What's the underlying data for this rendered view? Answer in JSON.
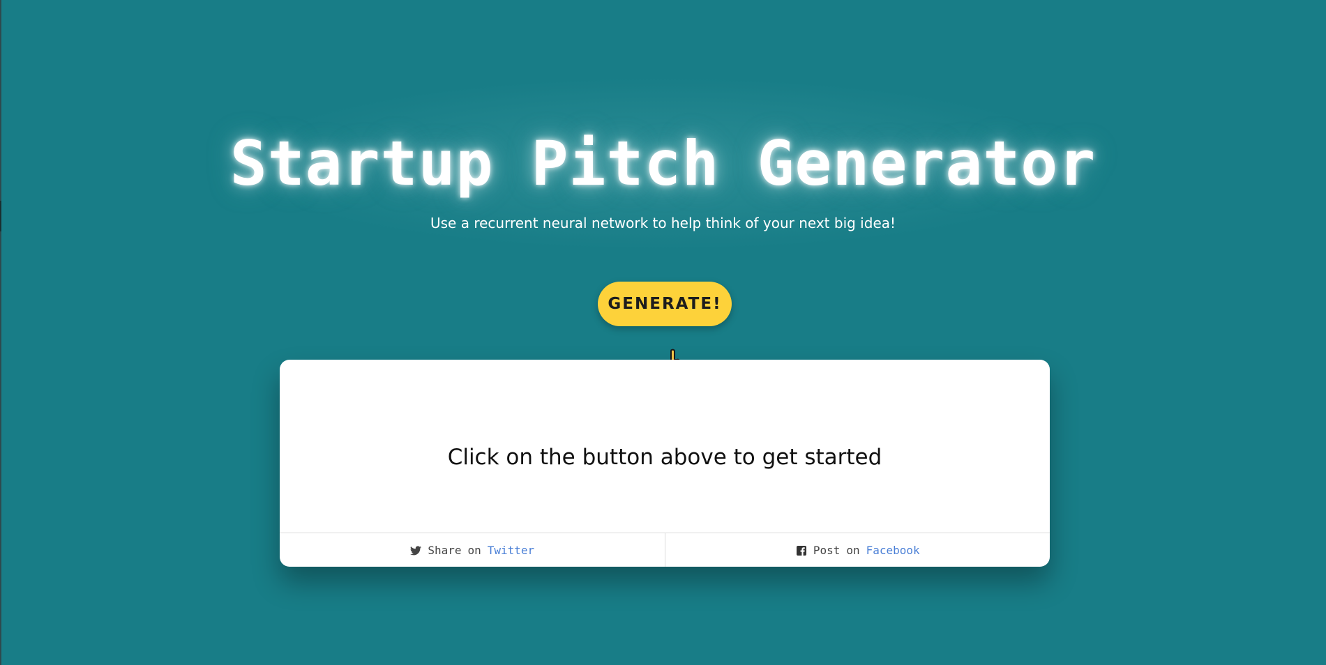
{
  "hero": {
    "title": "Startup Pitch Generator",
    "subtitle": "Use a recurrent neural network to help think of your next big idea!"
  },
  "generate_button": {
    "label": "GENERATE!",
    "color": "#fdd23a"
  },
  "pointer": {
    "icon": "pointing-up-hand-icon"
  },
  "card": {
    "message": "Click on the button above to get started",
    "share": [
      {
        "icon": "twitter-icon",
        "verb": "Share",
        "preposition": "on",
        "network": "Twitter"
      },
      {
        "icon": "facebook-icon",
        "verb": "Post",
        "preposition": "on",
        "network": "Facebook"
      }
    ]
  },
  "colors": {
    "background": "#187d87",
    "link": "#4a7fd6",
    "button": "#fdd23a"
  }
}
